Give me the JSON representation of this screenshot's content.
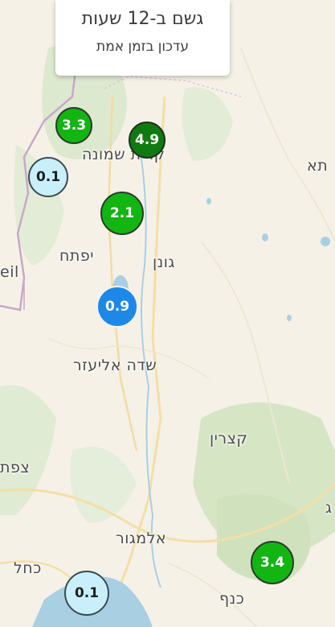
{
  "header": {
    "title": "גשם ב-12 שעות",
    "subtitle": "עדכון בזמן אמת"
  },
  "places": {
    "kiryat_shmona": "קרית שמונה",
    "yiftah": "יפתח",
    "gonen": "גונן",
    "sde_eliezer": "שדה אליעזר",
    "katzrin": "קצרין",
    "safed": "צפת",
    "almagor": "אלמגור",
    "kahal": "כחל",
    "kanaf": "כנף",
    "edge_left": "eil",
    "edge_right": "תא",
    "edge_right_lower": "ג"
  },
  "stations": [
    {
      "value": "3.3",
      "level": "green"
    },
    {
      "value": "4.9",
      "level": "darkgreen"
    },
    {
      "value": "0.1",
      "level": "light"
    },
    {
      "value": "2.1",
      "level": "green"
    },
    {
      "value": "0.9",
      "level": "blue"
    },
    {
      "value": "3.4",
      "level": "green"
    },
    {
      "value": "0.1",
      "level": "light"
    }
  ],
  "colors": {
    "land": "#f6f1e7",
    "forest": "#dbe8cc",
    "water": "#a9cfe3",
    "light_rain": "#c9f0fa",
    "moderate_rain": "#1e88e8",
    "heavy_rain": "#12b512",
    "very_heavy_rain": "#0f7a10"
  }
}
